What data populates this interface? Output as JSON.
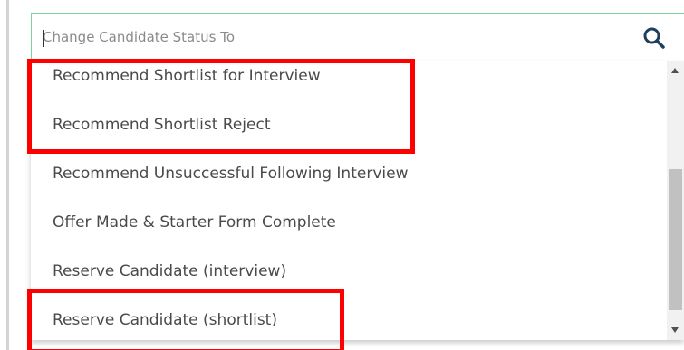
{
  "search": {
    "placeholder": "Change Candidate Status To",
    "value": ""
  },
  "icons": {
    "search": "search-icon",
    "scroll_up": "scroll-up-arrow",
    "scroll_down": "scroll-down-arrow"
  },
  "colors": {
    "accent_border": "#7fd3a2",
    "search_icon": "#1f3f5a",
    "highlight": "#ff0000"
  },
  "dropdown": {
    "options": [
      "Recommend Shortlist for Interview",
      "Recommend Shortlist Reject",
      "Recommend Unsuccessful Following Interview",
      "Offer Made & Starter Form Complete",
      "Reserve Candidate (interview)",
      "Reserve Candidate (shortlist)"
    ]
  }
}
